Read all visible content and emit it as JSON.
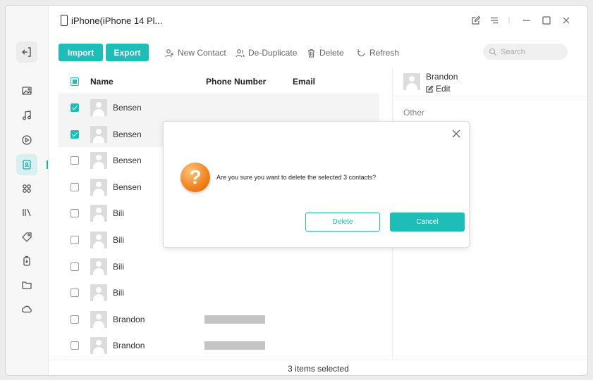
{
  "window": {
    "device_title": "iPhone(iPhone 14 Pl..."
  },
  "toolbar": {
    "import_label": "Import",
    "export_label": "Export",
    "new_contact_label": "New Contact",
    "de_duplicate_label": "De-Duplicate",
    "delete_label": "Delete",
    "refresh_label": "Refresh",
    "search_placeholder": "Search"
  },
  "table": {
    "headers": {
      "name": "Name",
      "phone": "Phone Number",
      "email": "Email"
    },
    "rows": [
      {
        "name": "Bensen",
        "checked": true
      },
      {
        "name": "Bensen",
        "checked": true
      },
      {
        "name": "Bensen",
        "checked": false
      },
      {
        "name": "Bensen",
        "checked": false
      },
      {
        "name": "Bili",
        "checked": false
      },
      {
        "name": "Bili",
        "checked": false
      },
      {
        "name": "Bili",
        "checked": false
      },
      {
        "name": "Bili",
        "checked": false
      },
      {
        "name": "Brandon",
        "checked": false
      },
      {
        "name": "Brandon",
        "checked": false
      }
    ]
  },
  "detail": {
    "name": "Brandon",
    "edit_label": "Edit",
    "section_label": "Other"
  },
  "status": {
    "text": "3 items selected"
  },
  "dialog": {
    "message": "Are you sure you want to delete the selected 3 contacts?",
    "delete_label": "Delete",
    "cancel_label": "Cancel"
  },
  "colors": {
    "accent": "#1fbdb8",
    "warning": "#f0821e"
  },
  "icons": {
    "sidebar": [
      "back-icon",
      "photos-icon",
      "music-icon",
      "video-icon",
      "contacts-icon",
      "apps-icon",
      "books-icon",
      "tags-icon",
      "backup-icon",
      "files-icon",
      "cloud-icon"
    ]
  }
}
